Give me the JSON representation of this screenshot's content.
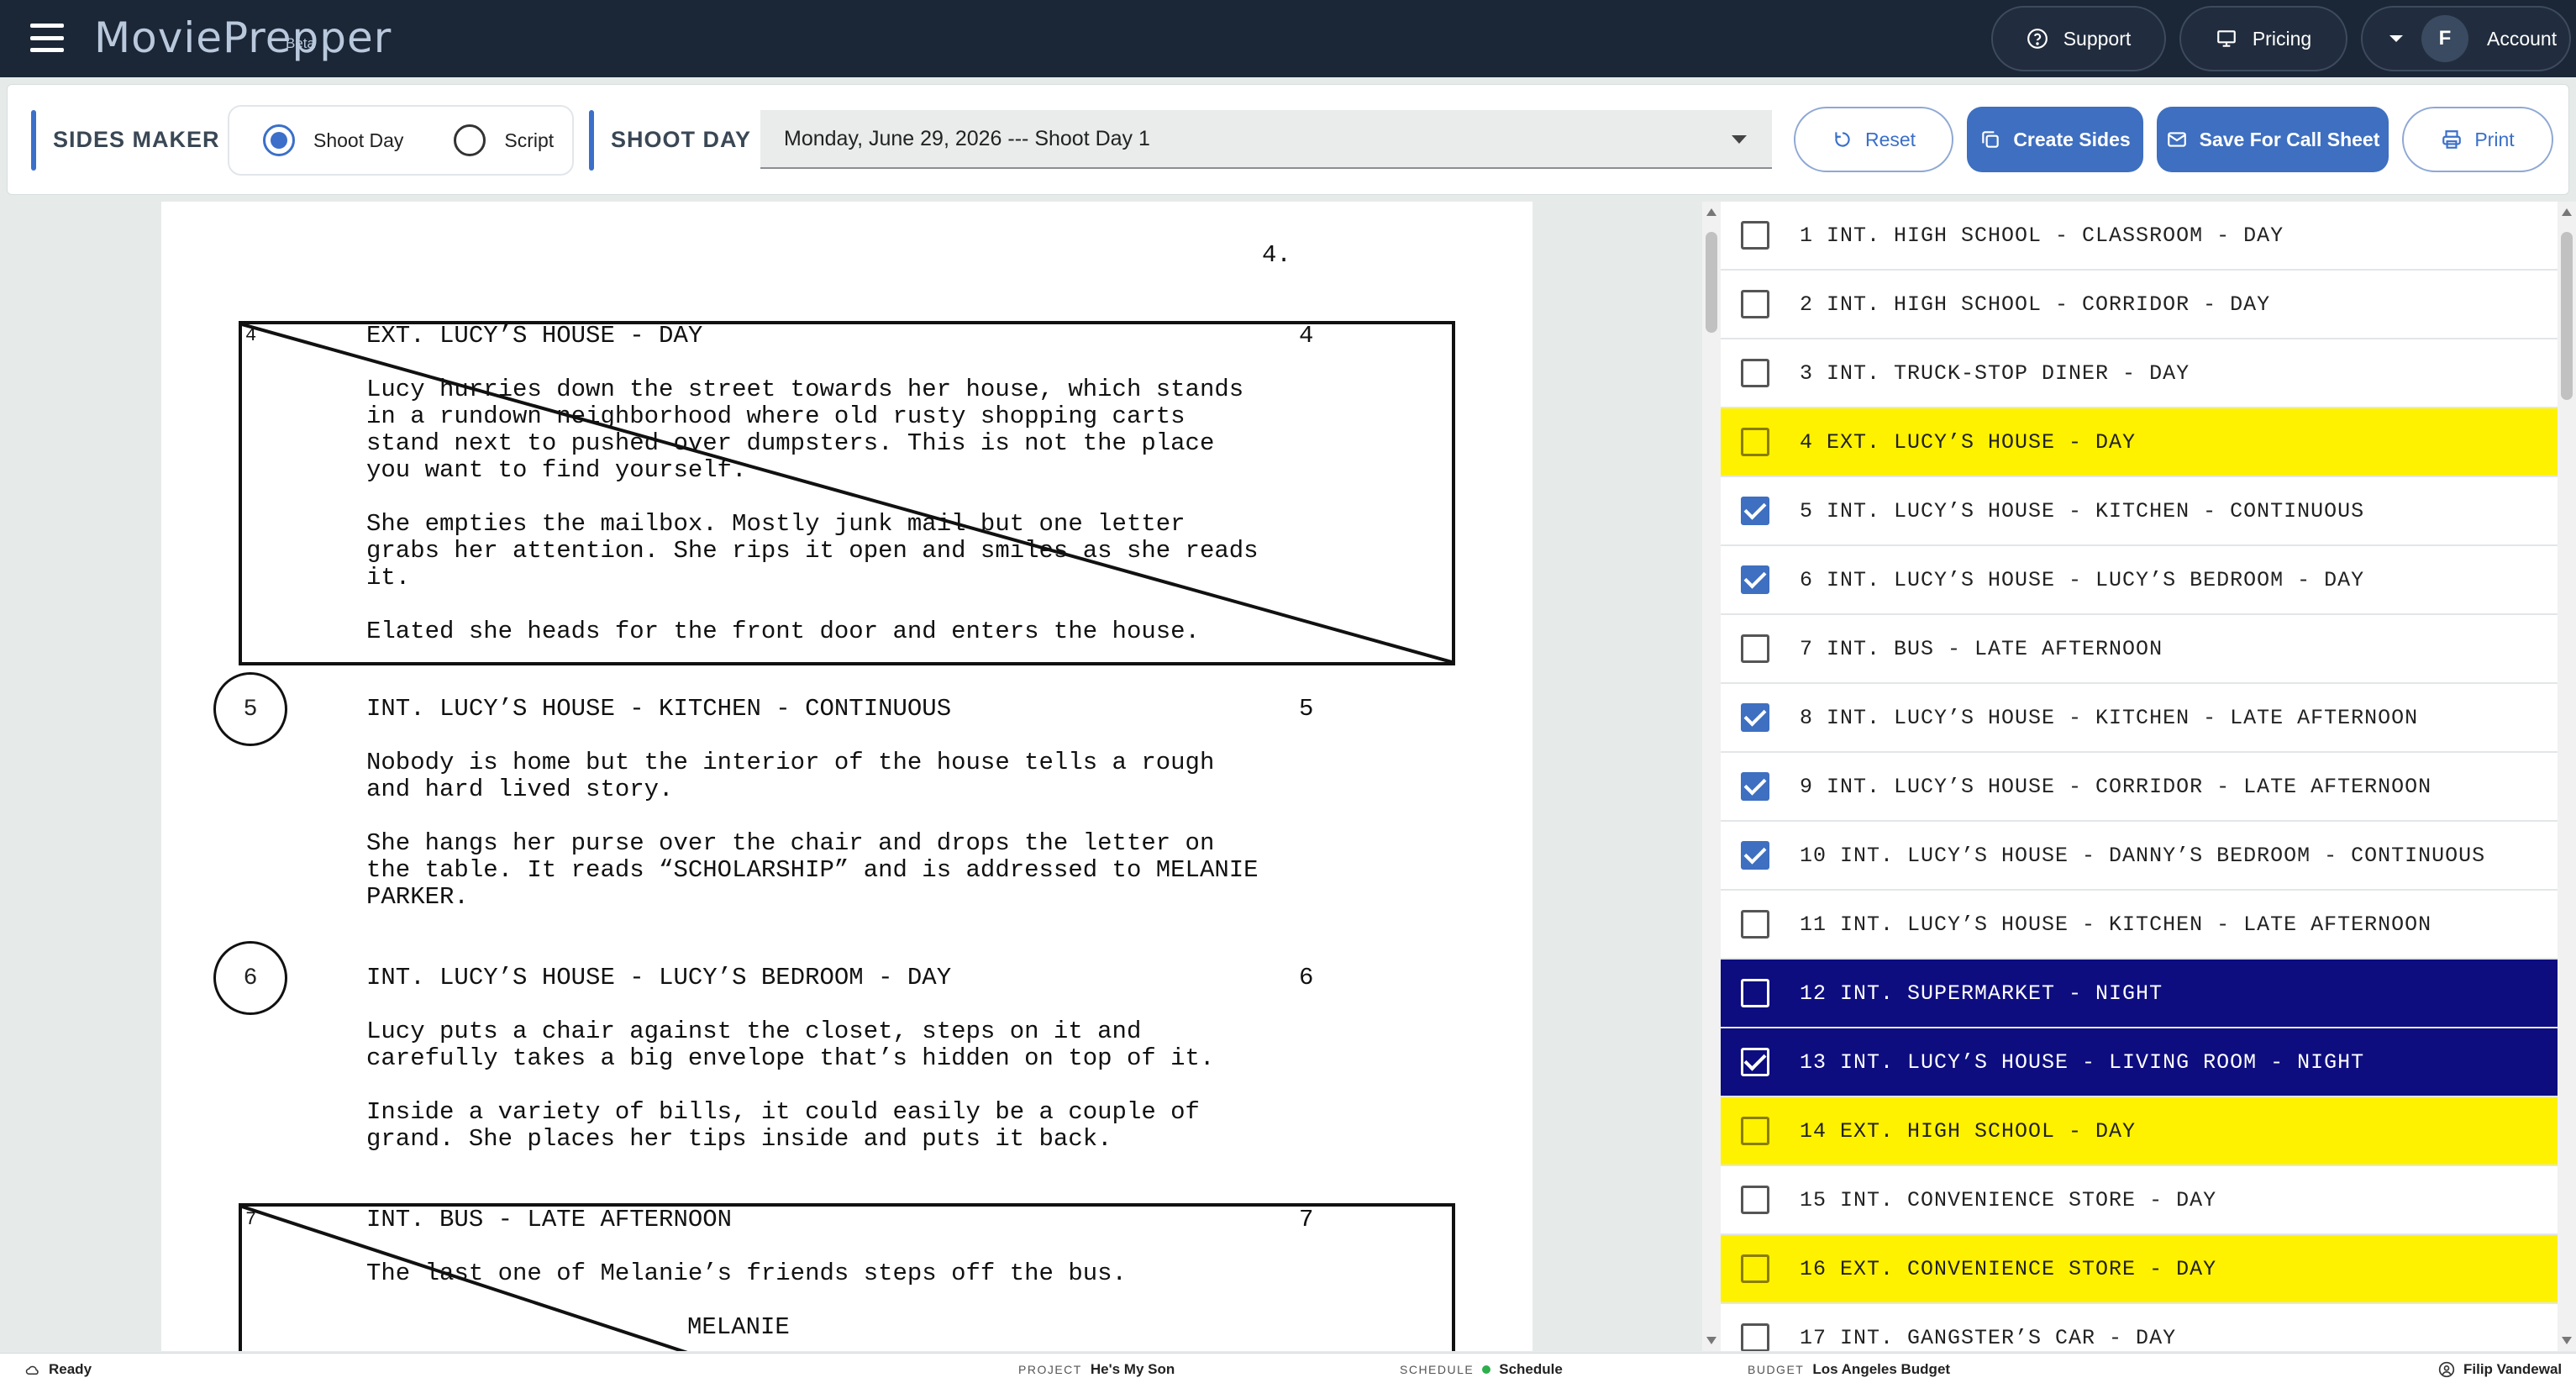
{
  "app": {
    "logo": "MoviePrepper",
    "beta": "Beta"
  },
  "nav": {
    "support": "Support",
    "pricing": "Pricing",
    "account_initial": "F",
    "account": "Account"
  },
  "toolbar": {
    "sides_maker": "SIDES MAKER",
    "radio_shoot_day": "Shoot Day",
    "radio_script": "Script",
    "selected_mode": "Shoot Day",
    "shoot_day_label": "SHOOT DAY",
    "shoot_day_value": "Monday, June 29, 2026 --- Shoot Day 1",
    "reset": "Reset",
    "create_sides": "Create Sides",
    "save_call_sheet": "Save For Call Sheet",
    "print": "Print"
  },
  "script": {
    "page_number": "4.",
    "scenes": [
      {
        "num": "4",
        "heading": "EXT. LUCY’S HOUSE - DAY",
        "struck": true,
        "action": [
          "Lucy hurries down the street towards her house, which stands\nin a rundown neighborhood where old rusty shopping carts\nstand next to pushed over dumpsters. This is not the place\nyou want to find yourself.",
          "She empties the mailbox. Mostly junk mail but one letter\ngrabs her attention. She rips it open and smiles as she reads\nit.",
          "Elated she heads for the front door and enters the house."
        ]
      },
      {
        "num": "5",
        "heading": "INT. LUCY’S HOUSE - KITCHEN - CONTINUOUS",
        "struck": false,
        "action": [
          "Nobody is home but the interior of the house tells a rough\nand hard lived story.",
          "She hangs her purse over the chair and drops the letter on\nthe table. It reads “SCHOLARSHIP” and is addressed to MELANIE\nPARKER."
        ]
      },
      {
        "num": "6",
        "heading": "INT. LUCY’S HOUSE - LUCY’S BEDROOM - DAY",
        "struck": false,
        "action": [
          "Lucy puts a chair against the closet, steps on it and\ncarefully takes a big envelope that’s hidden on top of it.",
          "Inside a variety of bills, it could easily be a couple of\ngrand. She places her tips inside and puts it back."
        ]
      },
      {
        "num": "7",
        "heading": "INT. BUS - LATE AFTERNOON",
        "struck": true,
        "action": [
          "The last one of Melanie’s friends steps off the bus."
        ],
        "character": "MELANIE"
      }
    ]
  },
  "scene_list": [
    {
      "label": "1 INT. HIGH SCHOOL - CLASSROOM - DAY",
      "checked": false,
      "style": "plain"
    },
    {
      "label": "2 INT. HIGH SCHOOL - CORRIDOR - DAY",
      "checked": false,
      "style": "plain"
    },
    {
      "label": "3 INT. TRUCK-STOP DINER - DAY",
      "checked": false,
      "style": "plain"
    },
    {
      "label": "4 EXT. LUCY’S HOUSE - DAY",
      "checked": false,
      "style": "yellow"
    },
    {
      "label": "5 INT. LUCY’S HOUSE - KITCHEN - CONTINUOUS",
      "checked": true,
      "style": "plain"
    },
    {
      "label": "6 INT. LUCY’S HOUSE - LUCY’S BEDROOM - DAY",
      "checked": true,
      "style": "plain"
    },
    {
      "label": "7 INT. BUS - LATE AFTERNOON",
      "checked": false,
      "style": "plain"
    },
    {
      "label": "8 INT. LUCY’S HOUSE - KITCHEN - LATE AFTERNOON",
      "checked": true,
      "style": "plain"
    },
    {
      "label": "9 INT. LUCY’S HOUSE - CORRIDOR - LATE AFTERNOON",
      "checked": true,
      "style": "plain"
    },
    {
      "label": "10 INT. LUCY’S HOUSE - DANNY’S BEDROOM - CONTINUOUS",
      "checked": true,
      "style": "plain"
    },
    {
      "label": "11 INT. LUCY’S HOUSE - KITCHEN - LATE AFTERNOON",
      "checked": false,
      "style": "plain"
    },
    {
      "label": "12 INT. SUPERMARKET - NIGHT",
      "checked": false,
      "style": "navy"
    },
    {
      "label": "13 INT. LUCY’S HOUSE - LIVING ROOM - NIGHT",
      "checked": true,
      "style": "navy"
    },
    {
      "label": "14 EXT. HIGH SCHOOL - DAY",
      "checked": false,
      "style": "yellow"
    },
    {
      "label": "15 INT. CONVENIENCE STORE - DAY",
      "checked": false,
      "style": "plain"
    },
    {
      "label": "16 EXT. CONVENIENCE STORE - DAY",
      "checked": false,
      "style": "yellow"
    },
    {
      "label": "17 INT. GANGSTER’S CAR - DAY",
      "checked": false,
      "style": "plain"
    }
  ],
  "status": {
    "ready": "Ready",
    "project_key": "PROJECT",
    "project": "He's My Son",
    "schedule_key": "SCHEDULE",
    "schedule": "Schedule",
    "budget_key": "BUDGET",
    "budget": "Los Angeles Budget",
    "user": "Filip Vandewal"
  },
  "colors": {
    "accent": "#3e6fc0",
    "nav_bg": "#1b2636",
    "yellow_strip": "#fff200",
    "navy_strip": "#0d0d80"
  }
}
